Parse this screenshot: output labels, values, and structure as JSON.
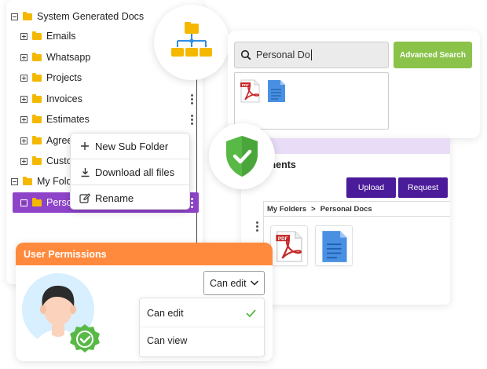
{
  "tree": {
    "root_label": "System Generated Docs",
    "items": [
      {
        "label": "Emails"
      },
      {
        "label": "Whatsapp"
      },
      {
        "label": "Projects"
      },
      {
        "label": "Invoices"
      },
      {
        "label": "Estimates"
      },
      {
        "label": "Agree"
      },
      {
        "label": "Custo"
      }
    ],
    "my_folders_label": "My Folde",
    "selected_label": "Person"
  },
  "context_menu": {
    "items": [
      {
        "label": "New Sub Folder",
        "icon": "plus-icon"
      },
      {
        "label": "Download all files",
        "icon": "download-icon"
      },
      {
        "label": "Rename",
        "icon": "rename-icon"
      }
    ]
  },
  "search": {
    "value": "Personal Do",
    "advanced_label": "Advanced Search"
  },
  "docs": {
    "title": "ments",
    "upload_label": "Upload",
    "request_label": "Request",
    "breadcrumb": {
      "root": "My Folders",
      "separator": ">",
      "current": "Personal Docs"
    }
  },
  "permissions": {
    "title": "User Permissions",
    "selected": "Can edit",
    "options": [
      {
        "label": "Can edit",
        "checked": true
      },
      {
        "label": "Can view",
        "checked": false
      }
    ]
  },
  "colors": {
    "accent_purple": "#8e44c9",
    "button_purple": "#4b1c99",
    "advanced_green": "#8bc34a",
    "permissions_orange": "#ff8a3d",
    "shield_green": "#58b947",
    "folder_yellow": "#f5b800",
    "org_blue": "#2f8de4"
  }
}
